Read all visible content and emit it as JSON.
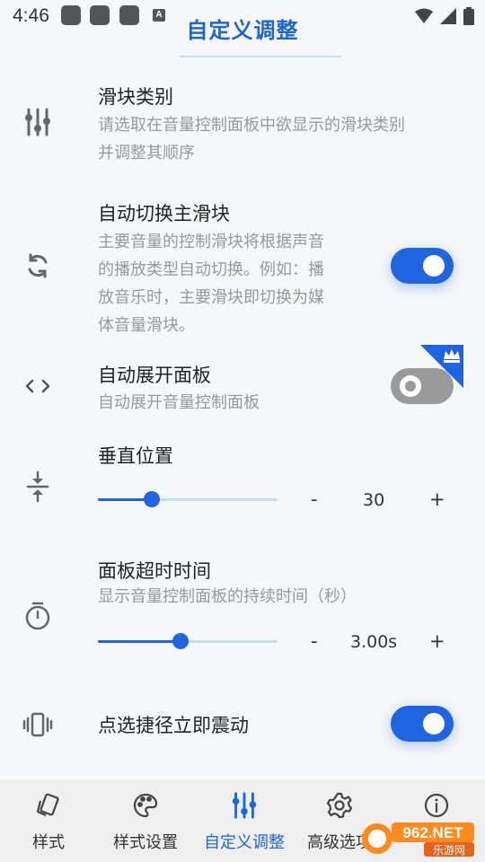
{
  "status_bar": {
    "time": "4:46",
    "notif_letter": "A"
  },
  "header": {
    "title": "自定义调整"
  },
  "rows": {
    "slider_type": {
      "title": "滑块类别",
      "desc_line1": "请选取在音量控制面板中欲显示的滑块类别",
      "desc_line2": "并调整其顺序"
    },
    "auto_switch": {
      "title": "自动切换主滑块",
      "desc_line1": "主要音量的控制滑块将根据声音",
      "desc_line2": "的播放类型自动切换。例如：播",
      "desc_line3": "放音乐时，主要滑块即切换为媒",
      "desc_line4": "体音量滑块。",
      "enabled": true
    },
    "auto_expand": {
      "title": "自动展开面板",
      "desc": "自动展开音量控制面板",
      "enabled": false,
      "premium": true
    },
    "vertical_position": {
      "title": "垂直位置",
      "minus": "-",
      "value": "30",
      "plus": "+",
      "level": 0.3
    },
    "panel_timeout": {
      "title": "面板超时时间",
      "desc": "显示音量控制面板的持续时间（秒）",
      "minus": "-",
      "value": "3.00s",
      "plus": "+",
      "level": 0.46
    },
    "vibrate": {
      "title": "点选捷径立即震动",
      "enabled": true
    }
  },
  "icons": {
    "slider_type": "sliders-icon",
    "auto_switch": "sync-icon",
    "auto_expand": "code-brackets-icon",
    "vertical_position": "vertical-align-icon",
    "panel_timeout": "stopwatch-icon",
    "vibrate": "vibrate-icon"
  },
  "bottom_nav": {
    "items": [
      {
        "label": "样式",
        "icon": "cards-icon"
      },
      {
        "label": "样式设置",
        "icon": "palette-icon"
      },
      {
        "label": "自定义调整",
        "icon": "sliders-icon"
      },
      {
        "label": "高级选项",
        "icon": "gear-icon"
      },
      {
        "label": "",
        "icon": "info-icon"
      }
    ],
    "active_index": 2
  },
  "watermark": {
    "brand": "962.NET",
    "sub": "乐游网"
  },
  "colors": {
    "accent": "#1f64e0",
    "toggle_off": "#9a9a9a",
    "premium_badge": "#1f64e0"
  }
}
